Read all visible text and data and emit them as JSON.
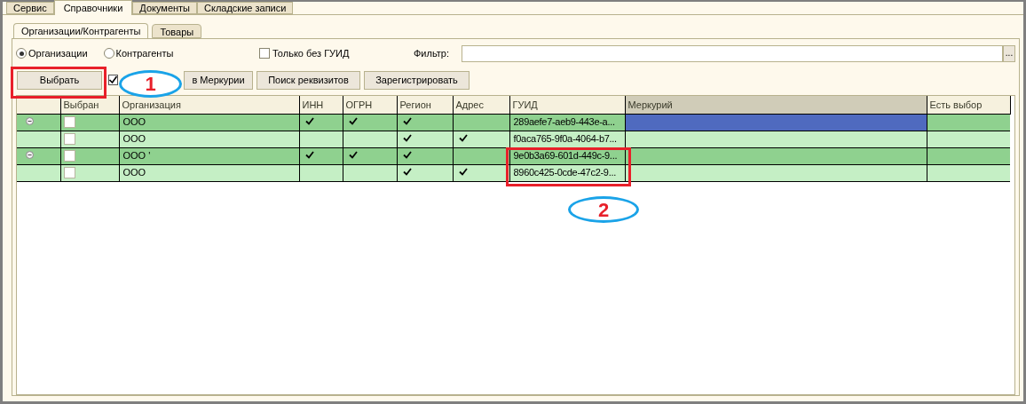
{
  "top_tabs": [
    {
      "label": "Сервис",
      "selected": false
    },
    {
      "label": "Справочники",
      "selected": true
    },
    {
      "label": "Документы",
      "selected": false
    },
    {
      "label": "Складские записи",
      "selected": false
    }
  ],
  "sub_tabs": [
    {
      "label": "Организации/Контрагенты",
      "selected": true
    },
    {
      "label": "Товары",
      "selected": false
    }
  ],
  "radios": [
    {
      "label": "Организации",
      "selected": true
    },
    {
      "label": "Контрагенты",
      "selected": false
    }
  ],
  "only_without_guid": {
    "label": "Только без ГУИД",
    "checked": false
  },
  "filter": {
    "label": "Фильтр:",
    "button": "..."
  },
  "toolbar": [
    {
      "kind": "plain",
      "label": "Выбрать"
    },
    {
      "kind": "icon",
      "label": "в Меркурии"
    },
    {
      "kind": "plain",
      "label": "Поиск реквизитов"
    },
    {
      "kind": "plain",
      "label": "Зарегистрировать"
    }
  ],
  "table": {
    "columns": [
      {
        "label": "Выбран",
        "selected": false
      },
      {
        "label": "Организация",
        "selected": false
      },
      {
        "label": "ИНН",
        "selected": false
      },
      {
        "label": "ОГРН",
        "selected": false
      },
      {
        "label": "Регион",
        "selected": false
      },
      {
        "label": "Адрес",
        "selected": false
      },
      {
        "label": "ГУИД",
        "selected": false
      },
      {
        "label": "Меркурий",
        "selected": true
      },
      {
        "label": "Есть выбор",
        "selected": false
      }
    ],
    "rows": [
      {
        "expanded": true,
        "checked": false,
        "organization": "ООО",
        "inn": true,
        "ogrn": true,
        "region": true,
        "address": false,
        "guid": "289aefe7-aeb9-443e-a...",
        "mercury_focused": true,
        "children": [
          {
            "checked": false,
            "organization": "ООО",
            "inn": false,
            "ogrn": false,
            "region": true,
            "address": true,
            "guid": "f0aca765-9f0a-4064-b7...",
            "mercury_focused": false
          }
        ]
      },
      {
        "expanded": true,
        "checked": false,
        "organization": "ООО '",
        "inn": true,
        "ogrn": true,
        "region": true,
        "address": false,
        "guid": "9e0b3a69-601d-449c-9...",
        "mercury_focused": false,
        "children": [
          {
            "checked": false,
            "organization": "ООО",
            "inn": false,
            "ogrn": false,
            "region": true,
            "address": true,
            "guid": "8960c425-0cde-47c2-9...",
            "mercury_focused": false
          }
        ]
      }
    ]
  },
  "annotations": [
    {
      "kind": "callout",
      "label": "1"
    },
    {
      "kind": "callout",
      "label": "2"
    }
  ]
}
